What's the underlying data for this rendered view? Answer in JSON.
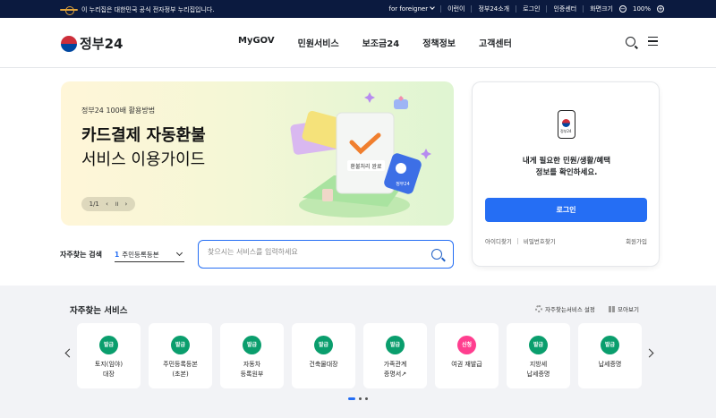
{
  "topbar": {
    "gov_notice": "이 누리집은 대한민국 공식 전자정부 누리집입니다.",
    "links": [
      "for foreigner",
      "이런이",
      "정부24소개",
      "로그인",
      "인증센터",
      "화면크기"
    ],
    "zoom": "100%"
  },
  "header": {
    "logo_text": "정부24",
    "nav": [
      "MyGOV",
      "민원서비스",
      "보조금24",
      "정책정보",
      "고객센터"
    ]
  },
  "banner": {
    "subtitle": "정부24 100배 활용방법",
    "title_line1": "카드결제 자동환불",
    "title_line2": "서비스 이용가이드",
    "page": "1/1",
    "receipt_text": "환불처리 완료",
    "card_text": "정부24"
  },
  "login": {
    "phone_label": "정부24",
    "message_line1": "내게 필요한 민원/생활/혜택",
    "message_line2": "정보를 확인하세요.",
    "button": "로그인",
    "find_id": "아이디찾기",
    "find_pw": "비밀번호찾기",
    "join": "회원가입"
  },
  "quick_search": {
    "label": "자주찾는 검색",
    "rank": "1",
    "selected": "주민등록등본",
    "placeholder": "찾으시는 서비스를 입력하세요"
  },
  "services": {
    "title": "자주찾는 서비스",
    "settings": "자주찾는서비스 설정",
    "view_all": "모아보기",
    "items": [
      {
        "badge": "발급",
        "label": "토지(임야)\n대장"
      },
      {
        "badge": "발급",
        "label": "주민등록등본\n(초본)"
      },
      {
        "badge": "발급",
        "label": "자동차\n등록원부"
      },
      {
        "badge": "발급",
        "label": "건축물대장"
      },
      {
        "badge": "발급",
        "label": "가족관계\n증명서↗"
      },
      {
        "badge": "신청",
        "label": "여권 재발급"
      },
      {
        "badge": "발급",
        "label": "지방세\n납세증명"
      },
      {
        "badge": "발급",
        "label": "납세증명"
      }
    ]
  },
  "colors": {
    "primary": "#256ef4",
    "issue_badge": "#0a9e6d",
    "apply_badge": "#ff3e8f",
    "topbar": "#0b1a3f"
  }
}
